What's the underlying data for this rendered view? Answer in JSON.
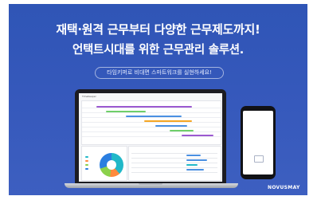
{
  "headline": {
    "line1": "재택·원격 근무부터 다양한 근무제도까지!",
    "line2": "언택트시대를 위한 근무관리 솔루션."
  },
  "subheadline": "타임키퍼로 비대면 스마트워크를 실현하세요!",
  "brand": "NOVUSMAY",
  "colors": {
    "background": "#3558bb",
    "text": "#ffffff"
  },
  "laptop_mockup": {
    "app_title": "TimeKeeper"
  },
  "phone_mockup": {}
}
